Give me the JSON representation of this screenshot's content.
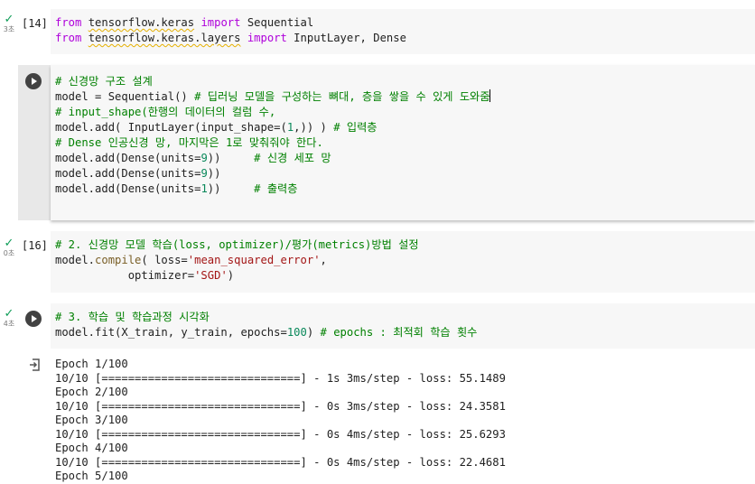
{
  "cells": [
    {
      "count": "[14]",
      "duration": "3초",
      "lines": [
        [
          [
            "from",
            "kw"
          ],
          [
            " ",
            ""
          ],
          [
            "tensorflow.keras",
            "sq"
          ],
          [
            " ",
            ""
          ],
          [
            "import",
            "kw"
          ],
          [
            " Sequential",
            ""
          ]
        ],
        [
          [
            "from",
            "kw"
          ],
          [
            " ",
            ""
          ],
          [
            "tensorflow.keras.layers",
            "sq"
          ],
          [
            " ",
            ""
          ],
          [
            "import",
            "kw"
          ],
          [
            " InputLayer, Dense",
            ""
          ]
        ]
      ]
    },
    {
      "lines": [
        [
          [
            "# 신경망 구조 설계",
            "cm"
          ]
        ],
        [
          [
            "model = Sequential() ",
            ""
          ],
          [
            "# 딥러닝 모델을 구성하는 뼈대, 층을 쌓을 수 있게 도와줌",
            "cm"
          ]
        ],
        [
          [
            "# input_shape(한행의 데이터의 컬럼 수,",
            "cm"
          ]
        ],
        [
          [
            "model.add( InputLayer(input_shape=(",
            ""
          ],
          [
            "1",
            "num"
          ],
          [
            ",)) ) ",
            ""
          ],
          [
            "# 입력층",
            "cm"
          ]
        ],
        [
          [
            "# Dense 인공신경 망, 마지막은 1로 맞춰줘야 한다.",
            "cm"
          ]
        ],
        [
          [
            "model.add(Dense(units=",
            ""
          ],
          [
            "9",
            "num"
          ],
          [
            "))     ",
            ""
          ],
          [
            "# 신경 세포 망",
            "cm"
          ]
        ],
        [
          [
            "model.add(Dense(units=",
            ""
          ],
          [
            "9",
            "num"
          ],
          [
            "))",
            ""
          ]
        ],
        [
          [
            "model.add(Dense(units=",
            ""
          ],
          [
            "1",
            "num"
          ],
          [
            "))     ",
            ""
          ],
          [
            "# 출력층",
            "cm"
          ]
        ]
      ]
    },
    {
      "count": "[16]",
      "duration": "0초",
      "lines": [
        [
          [
            "# 2. 신경망 모델 학습(loss, optimizer)/평가(metrics)방법 설정",
            "cm"
          ]
        ],
        [
          [
            "model.",
            ""
          ],
          [
            "compile",
            "fn"
          ],
          [
            "( loss=",
            ""
          ],
          [
            "'mean_squared_error'",
            "str"
          ],
          [
            ",",
            ""
          ]
        ],
        [
          [
            "           optimizer=",
            ""
          ],
          [
            "'SGD'",
            "str"
          ],
          [
            ")",
            ""
          ]
        ]
      ]
    },
    {
      "duration": "4초",
      "lines": [
        [
          [
            "# 3. 학습 및 학습과정 시각화",
            "cm"
          ]
        ],
        [
          [
            "model.fit(X_train, y_train, epochs=",
            ""
          ],
          [
            "100",
            "num"
          ],
          [
            ") ",
            ""
          ],
          [
            "# epochs : 최적회 학습 횟수",
            "cm"
          ]
        ]
      ]
    }
  ],
  "output": [
    "Epoch 1/100",
    "10/10 [==============================] - 1s 3ms/step - loss: 55.1489",
    "Epoch 2/100",
    "10/10 [==============================] - 0s 3ms/step - loss: 24.3581",
    "Epoch 3/100",
    "10/10 [==============================] - 0s 4ms/step - loss: 25.6293",
    "Epoch 4/100",
    "10/10 [==============================] - 0s 4ms/step - loss: 22.4681",
    "Epoch 5/100"
  ]
}
